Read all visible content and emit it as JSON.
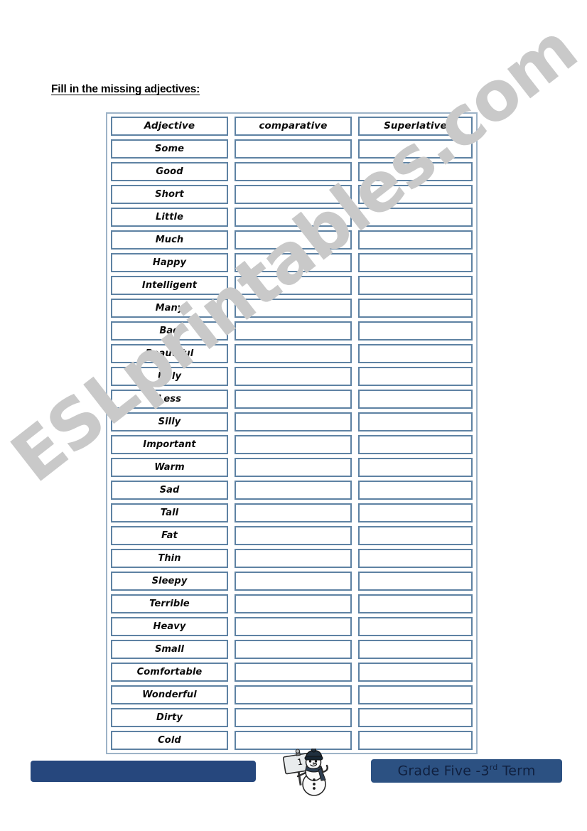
{
  "title": "Fill in the missing adjectives:",
  "table": {
    "headers": [
      "Adjective",
      "comparative",
      "Superlative"
    ],
    "rows": [
      "Some",
      "Good",
      "Short",
      "Little",
      "Much",
      "Happy",
      "Intelligent",
      "Many",
      "Bad",
      "Beautiful",
      "Ugly",
      "Less",
      "Silly",
      "Important",
      "Warm",
      "Sad",
      "Tall",
      "Fat",
      "Thin",
      "Sleepy",
      "Terrible",
      "Heavy",
      "Small",
      "Comfortable",
      "Wonderful",
      "Dirty",
      "Cold"
    ]
  },
  "watermark": {
    "text": "ESLprintables.com",
    "color": "#c9c9c9"
  },
  "footer": {
    "left_bar_label": "",
    "right_bar_label_pre": "Grade Five -3",
    "right_bar_label_sup": "rd",
    "right_bar_label_post": " Term",
    "page_number": "1",
    "left_bar_color": "#26477d",
    "right_bar_color": "#2c5182"
  },
  "colors": {
    "cell_border": "#5e82a3",
    "table_border": "#9db3c7",
    "page_background": "#ffffff"
  }
}
